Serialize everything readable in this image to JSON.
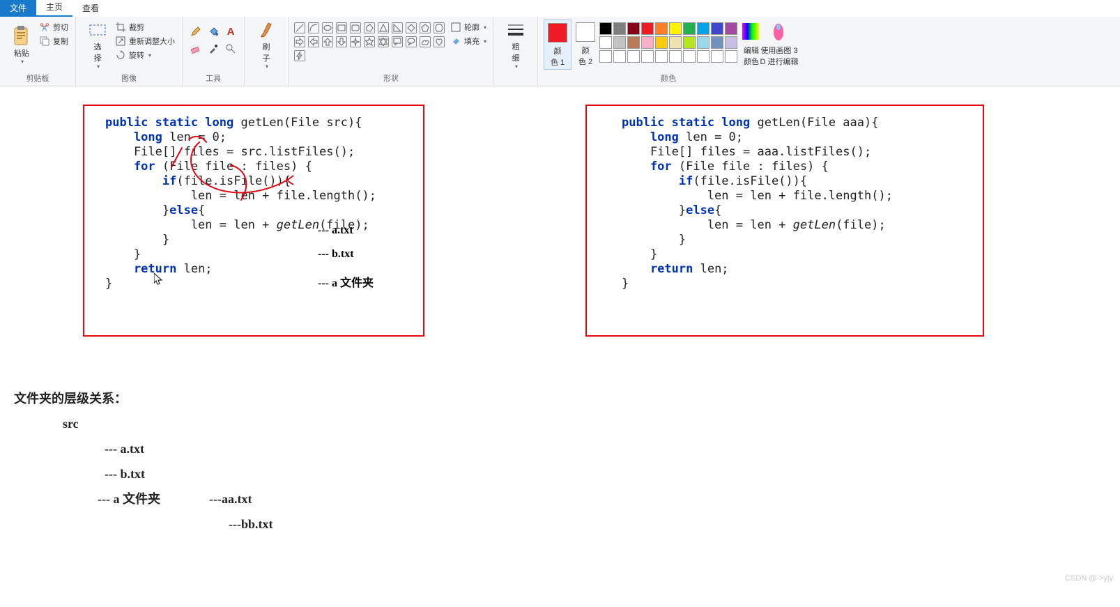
{
  "tabs": {
    "file": "文件",
    "home": "主页",
    "view": "查看"
  },
  "groups": {
    "clipboard": {
      "label": "剪贴板",
      "paste": "粘贴",
      "cut": "剪切",
      "copy": "复制"
    },
    "image": {
      "label": "图像",
      "select": "选\n择",
      "crop": "裁剪",
      "resize": "重新调整大小",
      "rotate": "旋转"
    },
    "tools": {
      "label": "工具"
    },
    "brushes": {
      "label": "刷\n子"
    },
    "shapes": {
      "label": "形状",
      "outline": "轮廓",
      "fill": "填充"
    },
    "stroke": {
      "label": "粗\n细"
    },
    "colors": {
      "label": "颜色",
      "color1": "颜\n色 1",
      "color2": "颜\n色 2",
      "edit": "编辑\n颜色",
      "paint3d": "使用画图 3\nD 进行编辑"
    }
  },
  "palette_row1": [
    "#000000",
    "#7f7f7f",
    "#880015",
    "#ed1c24",
    "#ff7f27",
    "#fff200",
    "#22b14c",
    "#00a2e8",
    "#3f48cc",
    "#a349a4"
  ],
  "palette_row2": [
    "#ffffff",
    "#c3c3c3",
    "#b97a57",
    "#ffaec9",
    "#ffc90e",
    "#efe4b0",
    "#b5e61d",
    "#99d9ea",
    "#7092be",
    "#c8bfe7"
  ],
  "palette_row3": [
    "#ffffff",
    "#ffffff",
    "#ffffff",
    "#ffffff",
    "#ffffff",
    "#ffffff",
    "#ffffff",
    "#ffffff",
    "#ffffff",
    "#ffffff"
  ],
  "color1_value": "#ed1c24",
  "color2_value": "#ffffff",
  "code_left": {
    "l1a": "public static",
    "l1b": " long ",
    "l1c": "getLen",
    "l1d": "(File src){",
    "l2a": "    long ",
    "l2b": "len = 0;",
    "l3": "    File[] files = src.listFiles();",
    "l4a": "    for ",
    "l4b": "(File file : files) {",
    "l5a": "        if",
    "l5b": "(file.isFile()){",
    "l6": "            len = len + file.length();",
    "l7a": "        }",
    "l7b": "else",
    "l7c": "{",
    "l8a": "            len = len + ",
    "l8b": "getLen",
    "l8c": "(file);",
    "l9": "        }",
    "l10": "    }",
    "l11a": "    return ",
    "l11b": "len;",
    "l12": "}"
  },
  "code_right": {
    "l1a": "public static long ",
    "l1b": "getLen",
    "l1c": "(File aaa){",
    "l2a": "    long ",
    "l2b": "len = 0;",
    "l3": "    File[] files = aaa.listFiles();",
    "l4a": "    for ",
    "l4b": "(File file : files) {",
    "l5a": "        if",
    "l5b": "(file.isFile()){",
    "l6": "            len = len + file.length();",
    "l7a": "        }",
    "l7b": "else",
    "l7c": "{",
    "l8a": "            len = len + ",
    "l8b": "getLen",
    "l8c": "(file);",
    "l9": "        }",
    "l10": "    }",
    "l11a": "    return ",
    "l11b": "len;",
    "l12": "}"
  },
  "annotations": {
    "a1": "--- a.txt",
    "a2": "--- b.txt",
    "a3": "--- a 文件夹"
  },
  "hierarchy": {
    "title": "文件夹的层级关系：",
    "root": "src",
    "c1": "--- a.txt",
    "c2": "--- b.txt",
    "c3": "--- a 文件夹",
    "c4": "---aa.txt",
    "c5": "---bb.txt"
  },
  "watermark": "CSDN @->yjy"
}
